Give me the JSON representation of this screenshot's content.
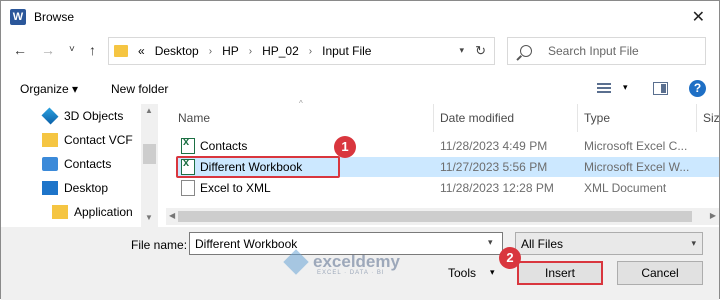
{
  "window": {
    "title": "Browse",
    "app_icon": "W",
    "close": "✕"
  },
  "nav": {
    "back": "←",
    "forward": "→",
    "recent": "˅",
    "up": "↑",
    "crumbs": [
      "«",
      "Desktop",
      "HP",
      "HP_02",
      "Input File"
    ],
    "crumb_sep": "›",
    "refresh": "↻",
    "search_placeholder": "Search Input File"
  },
  "toolbar": {
    "organize": "Organize ▾",
    "new_folder": "New folder",
    "view_drop": "▾",
    "help": "?"
  },
  "tree": [
    {
      "label": "3D Objects",
      "icon": "cube-3d-icon"
    },
    {
      "label": "Contact VCF",
      "icon": "folder-icon"
    },
    {
      "label": "Contacts",
      "icon": "contacts-icon"
    },
    {
      "label": "Desktop",
      "icon": "desktop-icon"
    },
    {
      "label": "Application",
      "icon": "folder-icon"
    }
  ],
  "columns": {
    "name": "Name",
    "date": "Date modified",
    "type": "Type",
    "size": "Size"
  },
  "files": [
    {
      "name": "Contacts",
      "date": "11/28/2023 4:49 PM",
      "type": "Microsoft Excel C...",
      "icon": "excel-file-icon"
    },
    {
      "name": "Different Workbook",
      "date": "11/27/2023 5:56 PM",
      "type": "Microsoft Excel W...",
      "icon": "excel-file-icon",
      "selected": true
    },
    {
      "name": "Excel to XML",
      "date": "11/28/2023 12:28 PM",
      "type": "XML Document",
      "icon": "document-file-icon"
    }
  ],
  "bottom": {
    "file_name_label": "File name:",
    "file_name_value": "Different Workbook",
    "file_type": "All Files",
    "tools": "Tools",
    "insert": "Insert",
    "cancel": "Cancel"
  },
  "badges": [
    "1",
    "2"
  ],
  "watermark": {
    "name": "exceldemy",
    "tagline": "EXCEL · DATA · BI"
  },
  "colors": {
    "selected_row": "#cce8ff",
    "annotation": "#d9363e",
    "accent": "#1e6fc5"
  }
}
